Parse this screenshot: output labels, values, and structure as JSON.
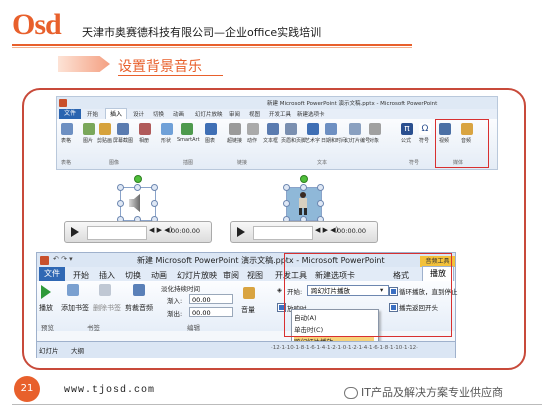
{
  "header": {
    "logo": "Osd",
    "company": "天津市奥赛德科技有限公司—企业office实践培训",
    "section_title": "设置背景音乐"
  },
  "ribbon1": {
    "title": "新建 Microsoft PowerPoint 演示文稿.pptx - Microsoft PowerPoint",
    "tabs": [
      "文件",
      "开始",
      "插入",
      "设计",
      "切换",
      "动画",
      "幻灯片放映",
      "审阅",
      "视图",
      "开发工具",
      "新建选项卡"
    ],
    "items": [
      "表格",
      "图片",
      "剪贴画",
      "屏幕截图",
      "相册",
      "形状",
      "SmartArt",
      "图表",
      "超链接",
      "动作",
      "文本框",
      "页眉和页脚",
      "艺术字",
      "日期和时间",
      "幻灯片编号",
      "对象",
      "公式",
      "符号",
      "视频",
      "音频"
    ],
    "groups": [
      "表格",
      "图像",
      "插图",
      "链接",
      "文本",
      "符号",
      "媒体"
    ]
  },
  "media_player": {
    "time": "00:00.00",
    "controls": "◀ ▶ ◀)"
  },
  "ribbon2": {
    "title": "新建 Microsoft PowerPoint 演示文稿.pptx - Microsoft PowerPoint",
    "context_label": "音频工具",
    "tabs": [
      "文件",
      "开始",
      "插入",
      "切换",
      "动画",
      "幻灯片放映",
      "审阅",
      "视图",
      "开发工具",
      "新建选项卡",
      "格式",
      "播放"
    ],
    "preview_label": "播放",
    "bookmark_add": "添加书签",
    "bookmark_remove": "删除书签",
    "trim": "剪裁音频",
    "fade_title": "淡化持续时间",
    "fade_in_label": "渐入:",
    "fade_in_value": "00.00",
    "fade_out_label": "渐出:",
    "fade_out_value": "00.00",
    "volume": "音量",
    "start_label": "开始:",
    "start_value": "跨幻灯片播放",
    "start_options": [
      "自动(A)",
      "单击时(C)",
      "跨幻灯片播放"
    ],
    "hide_label": "放映时",
    "loop_label": "循环播放，直到停止",
    "rewind_label": "播完返回开头",
    "groups": [
      "预览",
      "书签",
      "编辑"
    ],
    "bottom_tabs": [
      "幻灯片",
      "大纲"
    ],
    "ruler": "·12·1·10·1·8·1·6·1·4·1·2·1·0·1·2·1·4·1·6·1·8·1·10·1·12·"
  },
  "footer": {
    "page_number": "21",
    "website": "www.tjosd.com",
    "watermark": "IT产品及解决方案专业供应商"
  },
  "colors": {
    "accent": "#e8602c",
    "frame": "#c84a3a",
    "highlight_box": "#d83030"
  }
}
